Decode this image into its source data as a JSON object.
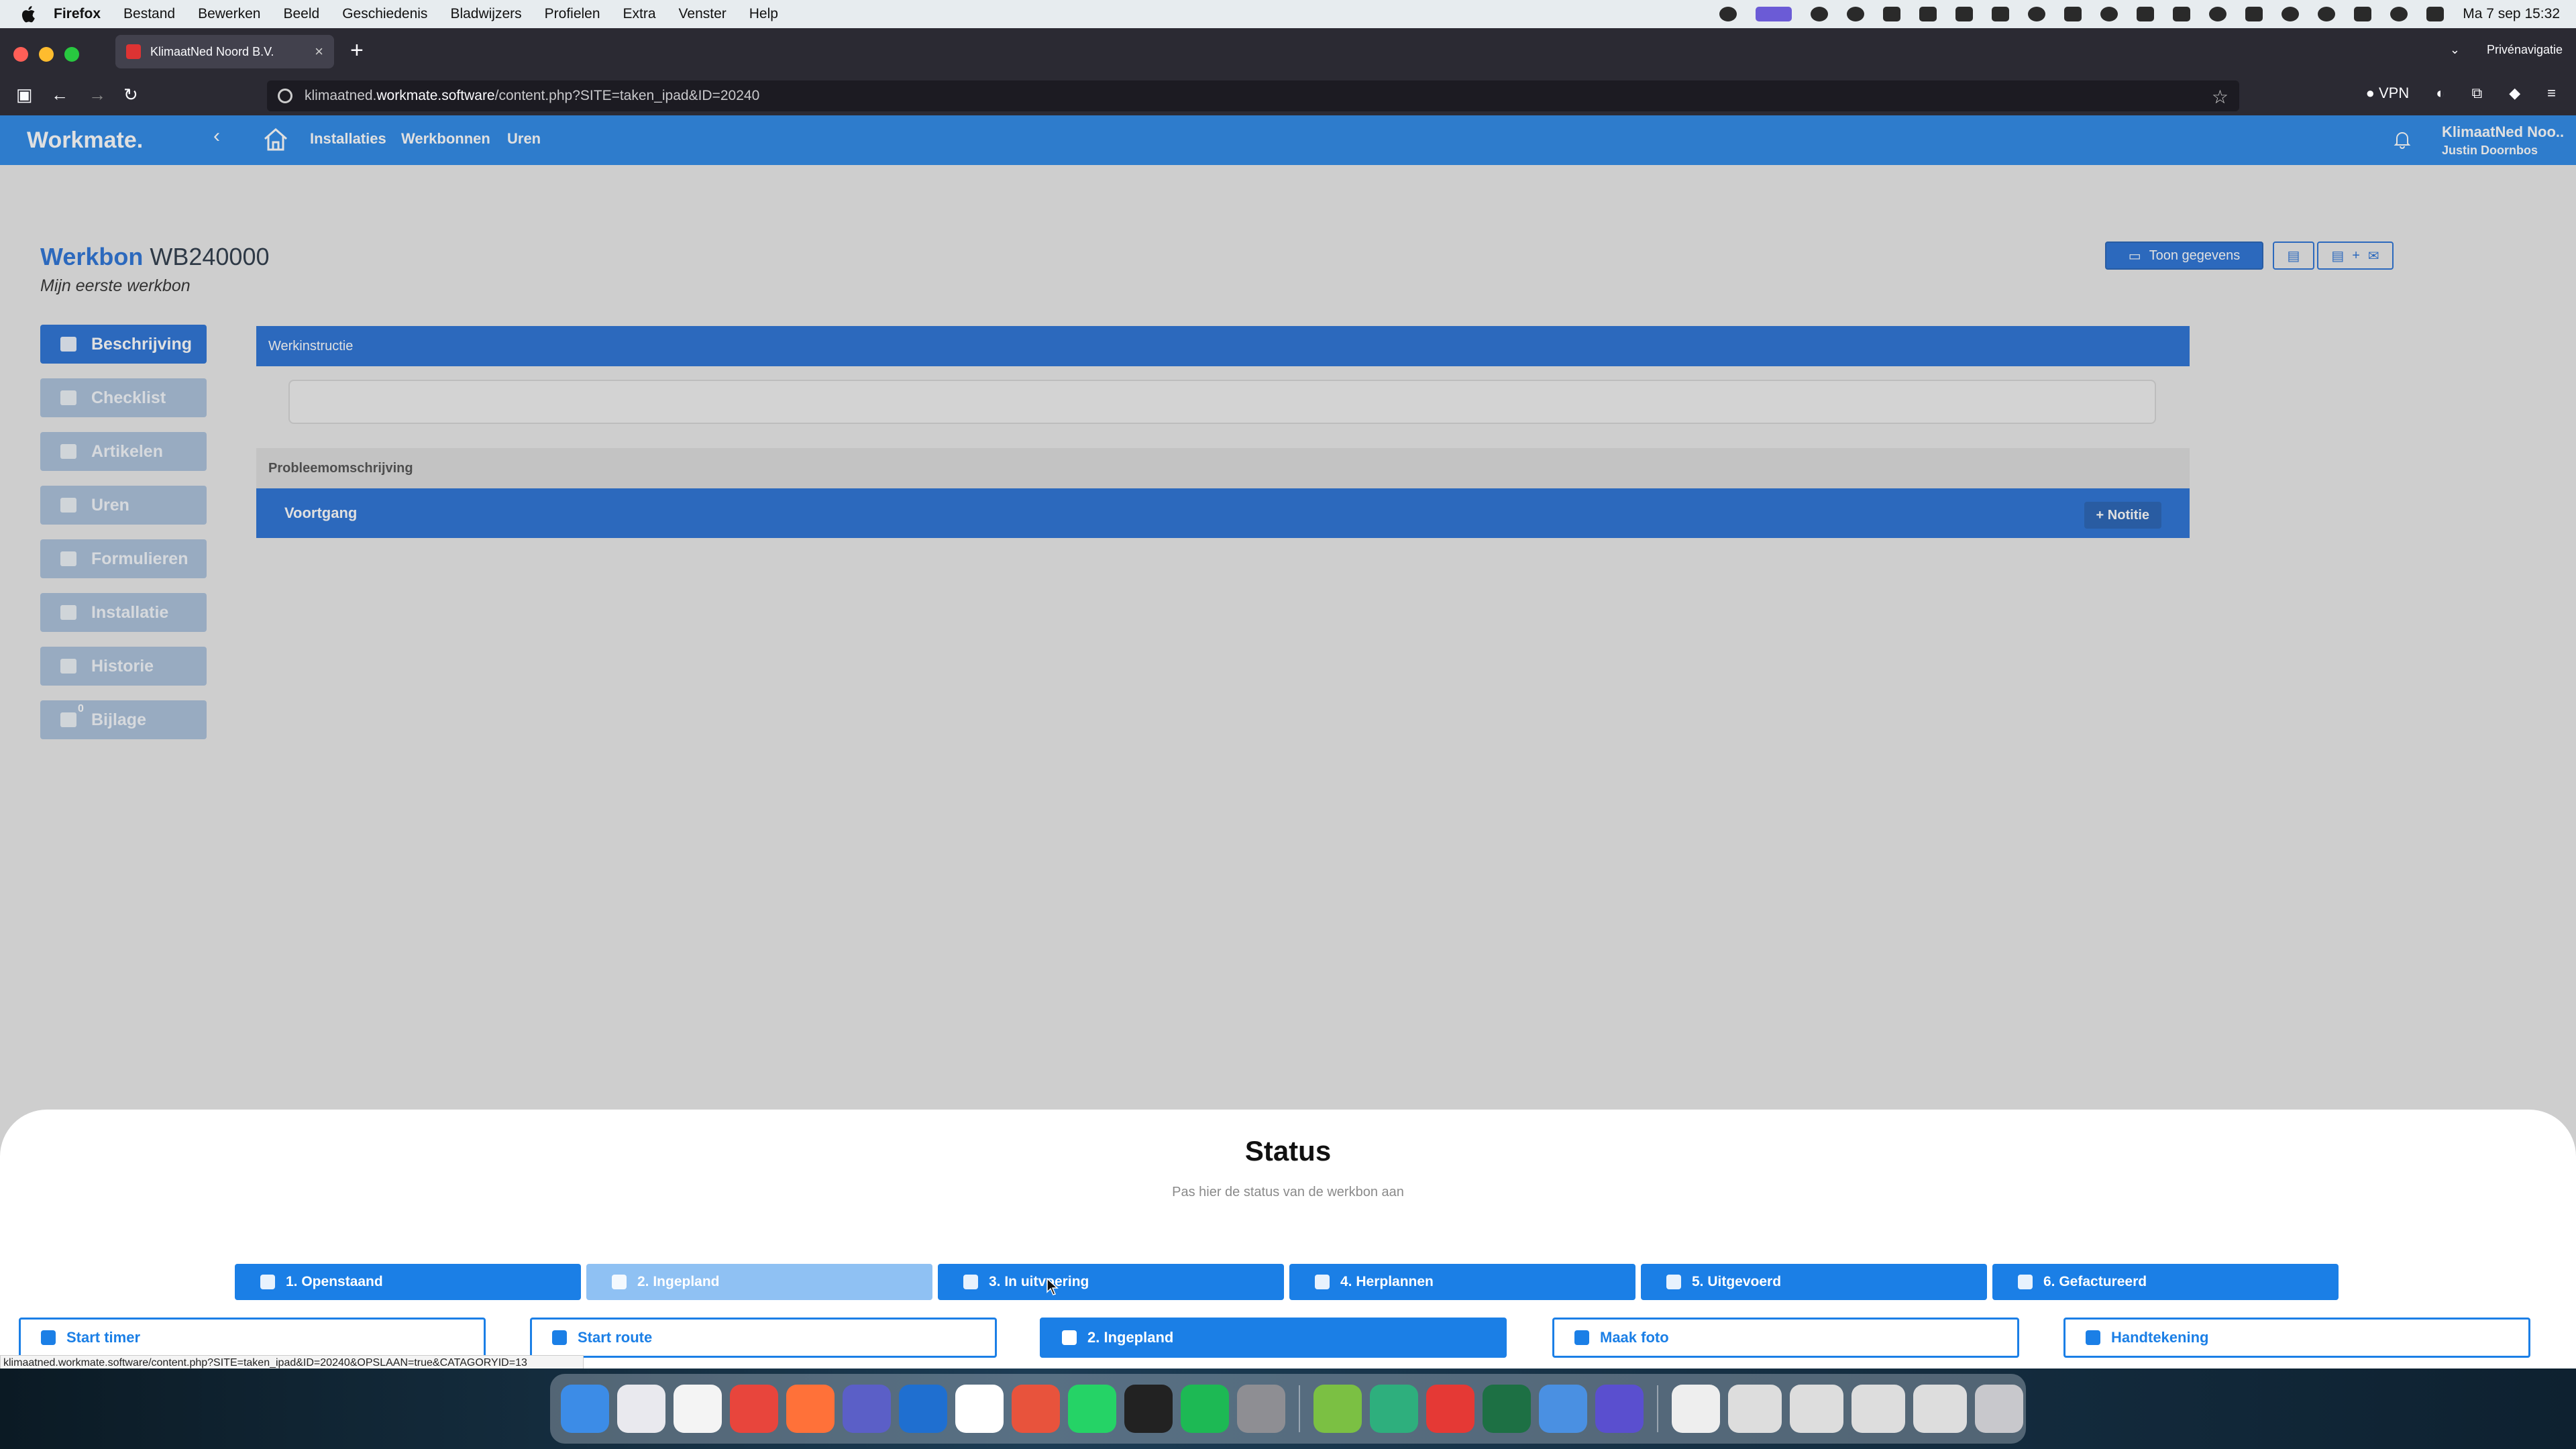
{
  "menubar": {
    "items": [
      "Firefox",
      "Bestand",
      "Bewerken",
      "Beeld",
      "Geschiedenis",
      "Bladwijzers",
      "Profielen",
      "Extra",
      "Venster",
      "Help"
    ],
    "clock": "Ma 7 sep  15:32"
  },
  "browser": {
    "tab_title": "KlimaatNed Noord B.V.",
    "url_prefix": "klimaatned.",
    "url_domain": "workmate.software",
    "url_path": "/content.php?SITE=taken_ipad&ID=20240",
    "private_label": "Privénavigatie",
    "vpn_label": "VPN",
    "status_url": "klimaatned.workmate.software/content.php?SITE=taken_ipad&ID=20240&OPSLAAN=true&CATAGORYID=13"
  },
  "app": {
    "logo": "Workmate.",
    "nav": [
      "Installaties",
      "Werkbonnen",
      "Uren"
    ],
    "company": "KlimaatNed Noo..",
    "user": "Justin Doornbos"
  },
  "werkbon": {
    "label": "Werkbon",
    "number": "WB240000",
    "subtitle": "Mijn eerste werkbon",
    "toon_gegevens": "Toon gegevens",
    "mail_label": "+"
  },
  "sidebar": {
    "items": [
      {
        "label": "Beschrijving",
        "active": true
      },
      {
        "label": "Checklist"
      },
      {
        "label": "Artikelen"
      },
      {
        "label": "Uren"
      },
      {
        "label": "Formulieren"
      },
      {
        "label": "Installatie"
      },
      {
        "label": "Historie"
      },
      {
        "label": "Bijlage",
        "badge": "0"
      }
    ]
  },
  "main": {
    "werkinstructie": "Werkinstructie",
    "probleem": "Probleemomschrijving",
    "voortgang": "Voortgang",
    "notitie": "+ Notitie"
  },
  "status_sheet": {
    "title": "Status",
    "subtitle": "Pas hier de status van de werkbon aan",
    "statuses": [
      {
        "label": "1. Openstaand",
        "icon": "calendar-icon"
      },
      {
        "label": "2. Ingepland",
        "icon": "calendar-icon",
        "current": true
      },
      {
        "label": "3. In uitvoering",
        "icon": "wrench-icon"
      },
      {
        "label": "4. Herplannen",
        "icon": "repeat-icon"
      },
      {
        "label": "5. Uitgevoerd",
        "icon": "check-circle-icon"
      },
      {
        "label": "6. Gefactureerd",
        "icon": "search-icon"
      }
    ],
    "actions": [
      {
        "label": "Start timer",
        "icon": "stopwatch-icon"
      },
      {
        "label": "Start route",
        "icon": "route-icon"
      },
      {
        "label": "2. Ingepland",
        "icon": "user-icon",
        "filled": true
      },
      {
        "label": "Maak foto",
        "icon": "camera-icon"
      },
      {
        "label": "Handtekening",
        "icon": "signature-icon"
      }
    ]
  },
  "colors": {
    "primary": "#1b7fe6",
    "primary_dark": "#1967d2",
    "inactive": "#a3bbd8"
  }
}
